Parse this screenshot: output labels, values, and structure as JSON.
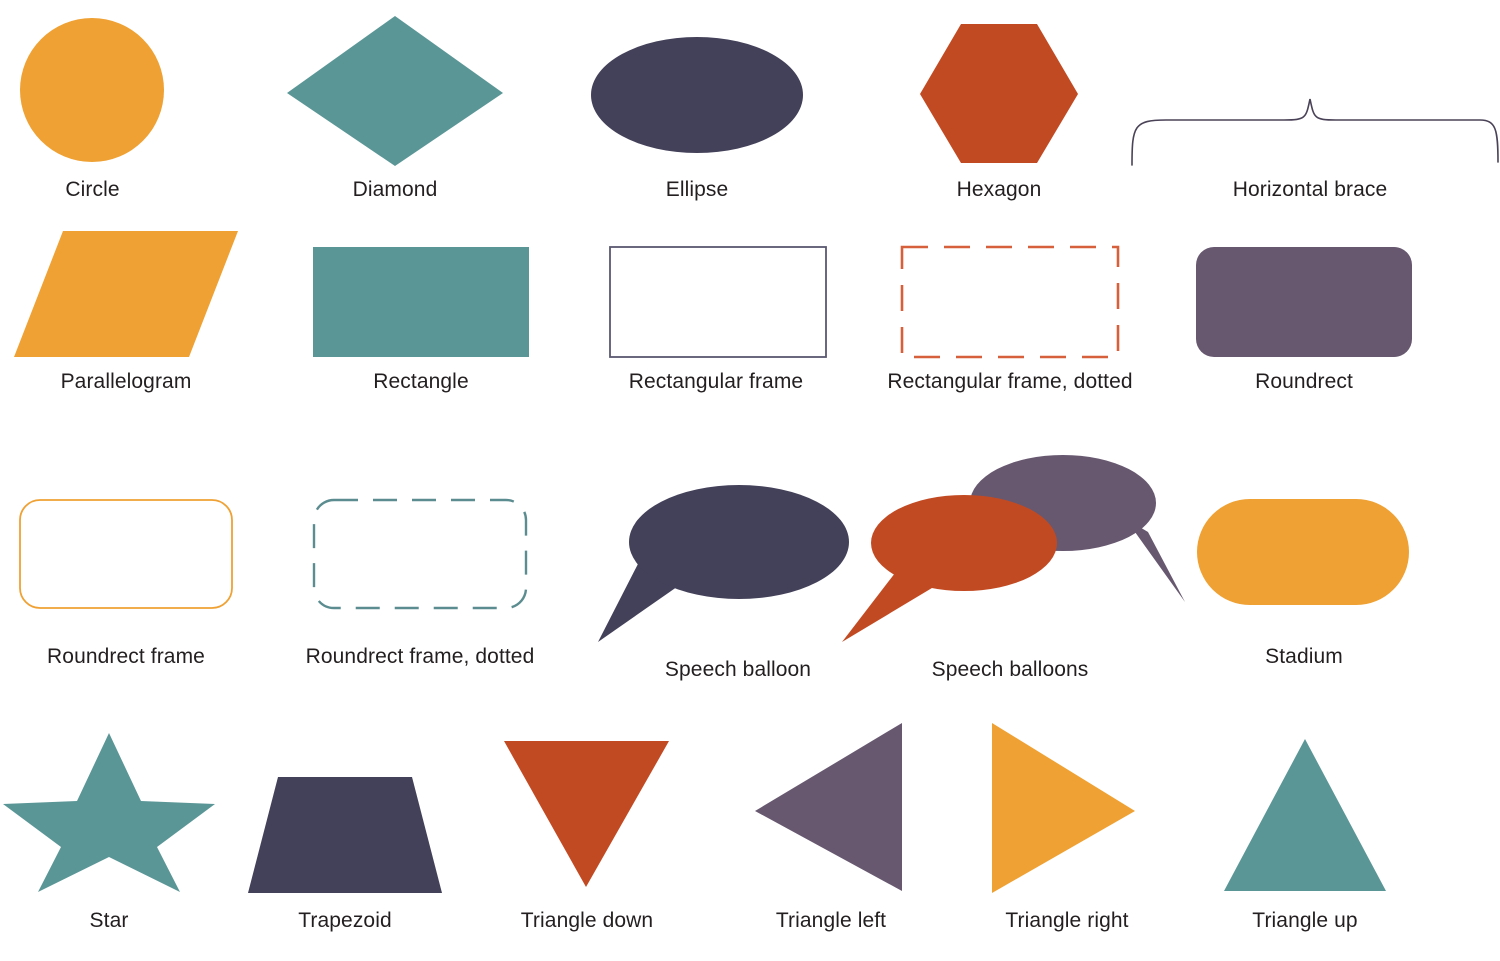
{
  "page": {
    "background": "#ffffff",
    "label_color": "#231f20",
    "label_font_size": 21
  },
  "palette": {
    "orange": "#efa133",
    "teal": "#5b9697",
    "navy": "#434059",
    "brick": "#c24a22",
    "purple": "#675870",
    "frame_navy": "#5a5870",
    "frame_orange": "#efa133",
    "frame_brick": "#d7603c",
    "frame_teal": "#5b8c90",
    "brace_line": "#4a4257"
  },
  "shapes": [
    {
      "id": "circle",
      "icon": "circle-shape",
      "label": "Circle",
      "fill": "#efa133",
      "row": 1,
      "col": 1
    },
    {
      "id": "diamond",
      "icon": "diamond-shape",
      "label": "Diamond",
      "fill": "#5b9697",
      "row": 1,
      "col": 2
    },
    {
      "id": "ellipse",
      "icon": "ellipse-shape",
      "label": "Ellipse",
      "fill": "#434059",
      "row": 1,
      "col": 3
    },
    {
      "id": "hexagon",
      "icon": "hexagon-shape",
      "label": "Hexagon",
      "fill": "#c24a22",
      "row": 1,
      "col": 4
    },
    {
      "id": "horizontal-brace",
      "icon": "horizontal-brace-shape",
      "label": "Horizontal brace",
      "stroke": "#4a4257",
      "row": 1,
      "col": 5
    },
    {
      "id": "parallelogram",
      "icon": "parallelogram-shape",
      "label": "Parallelogram",
      "fill": "#efa133",
      "row": 2,
      "col": 1
    },
    {
      "id": "rectangle",
      "icon": "rectangle-shape",
      "label": "Rectangle",
      "fill": "#5b9697",
      "row": 2,
      "col": 2
    },
    {
      "id": "rectangular-frame",
      "icon": "rectangular-frame-shape",
      "label": "Rectangular frame",
      "stroke": "#5a5870",
      "fill": "none",
      "row": 2,
      "col": 3
    },
    {
      "id": "rectangular-frame-dotted",
      "icon": "rectangular-frame-dotted-shape",
      "label": "Rectangular frame, dotted",
      "stroke": "#d7603c",
      "fill": "none",
      "row": 2,
      "col": 4
    },
    {
      "id": "roundrect",
      "icon": "roundrect-shape",
      "label": "Roundrect",
      "fill": "#675870",
      "row": 2,
      "col": 5
    },
    {
      "id": "roundrect-frame",
      "icon": "roundrect-frame-shape",
      "label": "Roundrect frame",
      "stroke": "#efa133",
      "fill": "none",
      "row": 3,
      "col": 1
    },
    {
      "id": "roundrect-frame-dotted",
      "icon": "roundrect-frame-dotted-shape",
      "label": "Roundrect frame, dotted",
      "stroke": "#5b8c90",
      "fill": "none",
      "row": 3,
      "col": 2
    },
    {
      "id": "speech-balloon",
      "icon": "speech-balloon-shape",
      "label": "Speech balloon",
      "fill": "#434059",
      "row": 3,
      "col": 3
    },
    {
      "id": "speech-balloons",
      "icon": "speech-balloons-shape",
      "label": "Speech balloons",
      "fill": "#c24a22",
      "fill2": "#675870",
      "row": 3,
      "col": 4
    },
    {
      "id": "stadium",
      "icon": "stadium-shape",
      "label": "Stadium",
      "fill": "#efa133",
      "row": 3,
      "col": 5
    },
    {
      "id": "star",
      "icon": "star-shape",
      "label": "Star",
      "fill": "#5b9697",
      "row": 4,
      "col": 1
    },
    {
      "id": "trapezoid",
      "icon": "trapezoid-shape",
      "label": "Trapezoid",
      "fill": "#434059",
      "row": 4,
      "col": 2
    },
    {
      "id": "triangle-down",
      "icon": "triangle-down-shape",
      "label": "Triangle down",
      "fill": "#c24a22",
      "row": 4,
      "col": 3
    },
    {
      "id": "triangle-left",
      "icon": "triangle-left-shape",
      "label": "Triangle left",
      "fill": "#675870",
      "row": 4,
      "col": 4
    },
    {
      "id": "triangle-right",
      "icon": "triangle-right-shape",
      "label": "Triangle right",
      "fill": "#efa133",
      "row": 4,
      "col": 5
    },
    {
      "id": "triangle-up",
      "icon": "triangle-up-shape",
      "label": "Triangle up",
      "fill": "#5b9697",
      "row": 4,
      "col": 6
    }
  ]
}
